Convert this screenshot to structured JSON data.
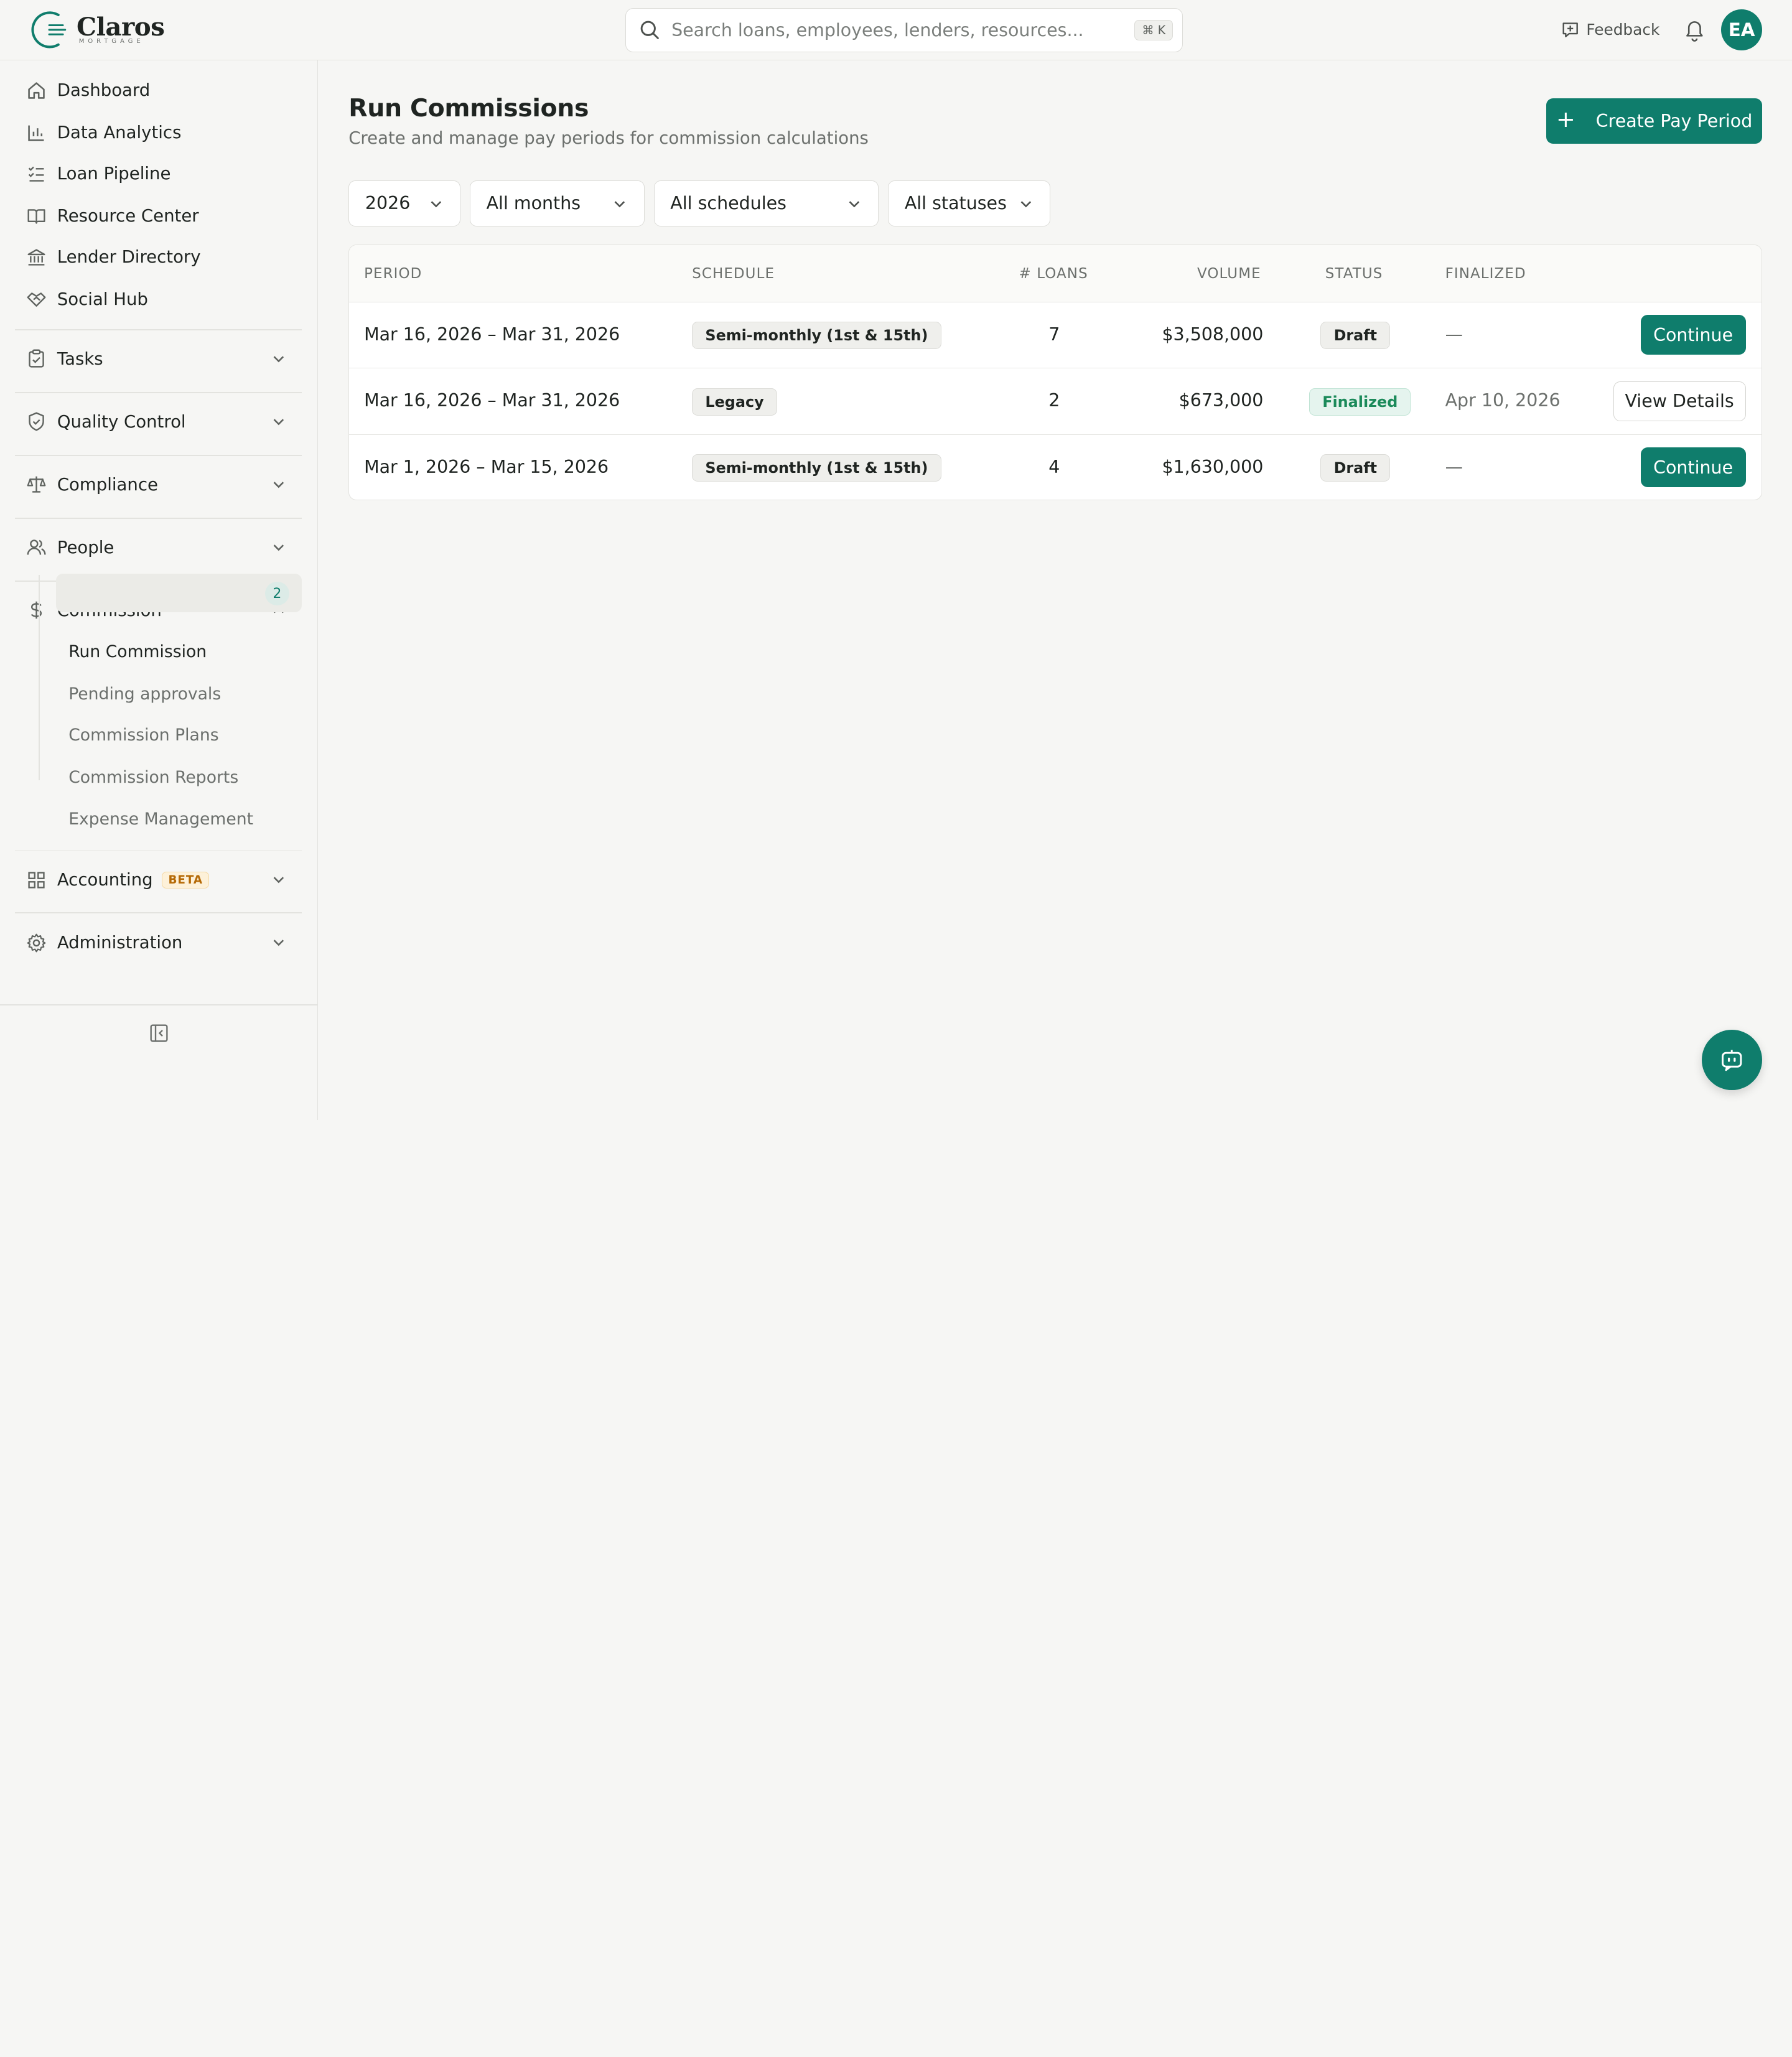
{
  "brand": {
    "name": "Claros",
    "tagline": "MORTGAGE",
    "accent": "#0f7d6c"
  },
  "search": {
    "placeholder": "Search loans, employees, lenders, resources...",
    "shortcut": "⌘ K"
  },
  "topbar": {
    "feedback_label": "Feedback",
    "avatar_initials": "EA"
  },
  "sidebar": {
    "items": [
      {
        "label": "Dashboard",
        "icon": "home-icon"
      },
      {
        "label": "Data Analytics",
        "icon": "bar-chart-icon"
      },
      {
        "label": "Loan Pipeline",
        "icon": "checklist-icon"
      },
      {
        "label": "Resource Center",
        "icon": "book-icon"
      },
      {
        "label": "Lender Directory",
        "icon": "bank-icon"
      },
      {
        "label": "Social Hub",
        "icon": "handshake-icon"
      }
    ],
    "groups": [
      {
        "label": "Tasks",
        "icon": "clipboard-icon",
        "expanded": false
      },
      {
        "label": "Quality Control",
        "icon": "shield-check-icon",
        "expanded": false
      },
      {
        "label": "Compliance",
        "icon": "scale-icon",
        "expanded": false
      },
      {
        "label": "People",
        "icon": "users-icon",
        "expanded": false
      },
      {
        "label": "Commission",
        "icon": "dollar-icon",
        "expanded": true
      },
      {
        "label": "Accounting",
        "icon": "grid-icon",
        "badge": "BETA",
        "expanded": false
      },
      {
        "label": "Administration",
        "icon": "gear-icon",
        "expanded": false
      }
    ],
    "commission_sub": [
      {
        "label": "Run Commission",
        "count": "2",
        "active": true
      },
      {
        "label": "Pending approvals"
      },
      {
        "label": "Commission Plans"
      },
      {
        "label": "Commission Reports"
      },
      {
        "label": "Expense Management"
      }
    ]
  },
  "main": {
    "title": "Run Commissions",
    "subtitle": "Create and manage pay periods for commission calculations",
    "create_button": "Create Pay Period",
    "filters": {
      "year": "2026",
      "month": "All months",
      "schedule": "All schedules",
      "status": "All statuses"
    },
    "table": {
      "headers": [
        "PERIOD",
        "SCHEDULE",
        "# LOANS",
        "VOLUME",
        "STATUS",
        "FINALIZED"
      ],
      "rows": [
        {
          "period": "Mar 16, 2026 – Mar 31, 2026",
          "schedule": "Semi-monthly (1st & 15th)",
          "loans": "7",
          "volume": "$3,508,000",
          "status": "Draft",
          "finalized": "—",
          "action": "Continue"
        },
        {
          "period": "Mar 16, 2026 – Mar 31, 2026",
          "schedule": "Legacy",
          "loans": "2",
          "volume": "$673,000",
          "status": "Finalized",
          "finalized": "Apr 10, 2026",
          "action": "View Details"
        },
        {
          "period": "Mar 1, 2026 – Mar 15, 2026",
          "schedule": "Semi-monthly (1st & 15th)",
          "loans": "4",
          "volume": "$1,630,000",
          "status": "Draft",
          "finalized": "—",
          "action": "Continue"
        }
      ]
    }
  }
}
